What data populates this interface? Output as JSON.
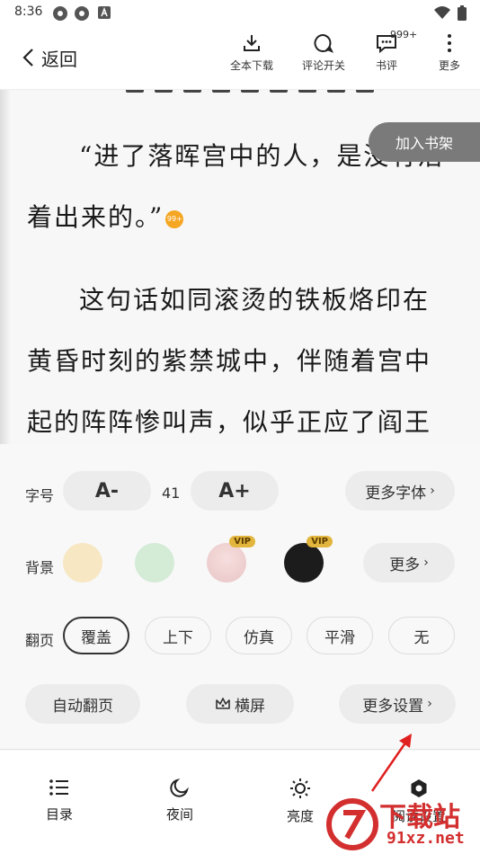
{
  "status": {
    "time": "8:36"
  },
  "header": {
    "back_label": "返回",
    "tools": [
      {
        "label": "全本下载",
        "icon": "download-icon"
      },
      {
        "label": "评论开关",
        "icon": "comment-icon"
      },
      {
        "label": "书评",
        "icon": "review-icon",
        "badge": "999+"
      },
      {
        "label": "更多",
        "icon": "more-icon"
      }
    ]
  },
  "reader": {
    "lines": [
      "“进了落晖宫中的人，是没有活",
      "着出来的。”",
      "这句话如同滚烫的铁板烙印在",
      "黄昏时刻的紫禁城中，伴随着宫中",
      "起的阵阵惨叫声，似乎正应了阎王"
    ],
    "comment_badge": "99+",
    "shelf_button": "加入书架"
  },
  "settings": {
    "font_label": "字号",
    "font_decrease": "A-",
    "font_size": "41",
    "font_increase": "A+",
    "more_fonts": "更多字体",
    "bg_label": "背景",
    "vip": "VIP",
    "bg_more": "更多",
    "colors": {
      "cream": "#f7e7c2",
      "green": "#d4ebd6",
      "dark": "#1c1c1c"
    },
    "page_label": "翻页",
    "page_modes": [
      "覆盖",
      "上下",
      "仿真",
      "平滑",
      "无"
    ],
    "auto_page": "自动翻页",
    "landscape": "横屏",
    "more_settings": "更多设置"
  },
  "nav": {
    "items": [
      {
        "label": "目录",
        "icon": "list-icon"
      },
      {
        "label": "夜间",
        "icon": "moon-icon"
      },
      {
        "label": "亮度",
        "icon": "sun-icon"
      },
      {
        "label": "阅读设置",
        "icon": "settings-icon"
      }
    ]
  },
  "watermark": {
    "line1": "下载站",
    "line2": "91xz.net"
  }
}
